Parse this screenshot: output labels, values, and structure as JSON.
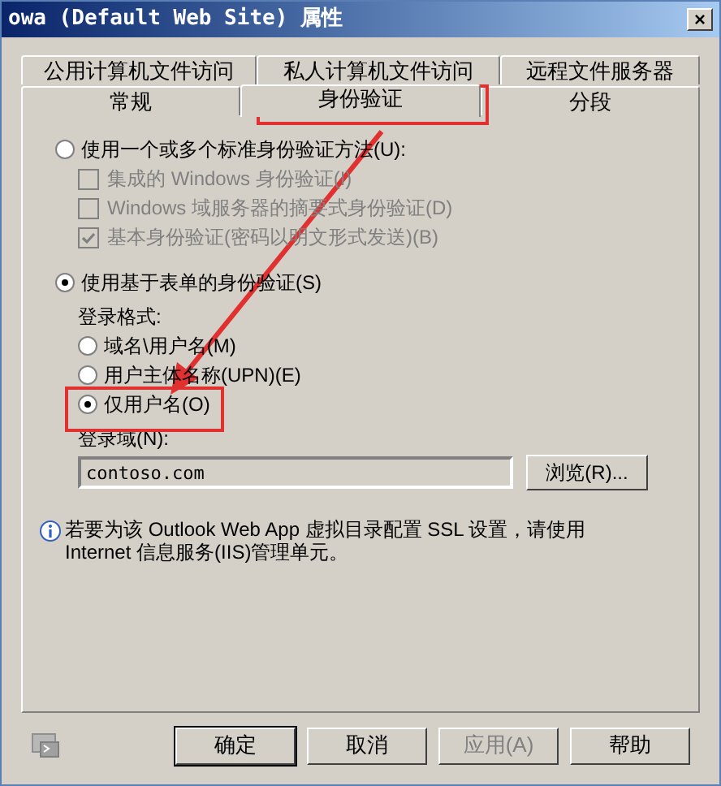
{
  "window": {
    "title": "owa (Default Web Site) 属性",
    "close": "×"
  },
  "tab_rows": [
    [
      {
        "label": "公用计算机文件访问",
        "selected": false
      },
      {
        "label": "私人计算机文件访问",
        "selected": false
      },
      {
        "label": "远程文件服务器",
        "selected": false
      }
    ],
    [
      {
        "label": "常规",
        "selected": false
      },
      {
        "label": "身份验证",
        "selected": true
      },
      {
        "label": "分段",
        "selected": false
      }
    ]
  ],
  "options": [
    {
      "kind": "radio",
      "label": "使用一个或多个标准身份验证方法(U):",
      "selected": false,
      "children": [
        {
          "kind": "checkbox",
          "label": "集成的 Windows 身份验证(I)",
          "checked": false,
          "disabled": true
        },
        {
          "kind": "checkbox",
          "label": "Windows 域服务器的摘要式身份验证(D)",
          "checked": false,
          "disabled": true
        },
        {
          "kind": "checkbox",
          "label": "基本身份验证(密码以明文形式发送)(B)",
          "checked": true,
          "disabled": true
        }
      ]
    },
    {
      "kind": "radio",
      "label": "使用基于表单的身份验证(S)",
      "selected": true,
      "children": [
        {
          "kind": "heading",
          "label": "登录格式:"
        },
        {
          "kind": "radio",
          "label": "域名\\用户名(M)",
          "selected": false
        },
        {
          "kind": "radio",
          "label": "用户主体名称(UPN)(E)",
          "selected": false
        },
        {
          "kind": "radio",
          "label": "仅用户名(O)",
          "selected": true
        },
        {
          "kind": "heading",
          "label": "登录域(N):"
        },
        {
          "kind": "field",
          "value": "contoso.com",
          "button": "浏览(R)..."
        }
      ]
    }
  ],
  "info": "若要为该 Outlook Web App 虚拟目录配置 SSL 设置，请使用 Internet 信息服务(IIS)管理单元。",
  "buttons": [
    {
      "label": "确定",
      "disabled": false,
      "default": true
    },
    {
      "label": "取消",
      "disabled": false,
      "default": false
    },
    {
      "label": "应用(A)",
      "disabled": true,
      "default": false
    },
    {
      "label": "帮助",
      "disabled": false,
      "default": false
    }
  ]
}
